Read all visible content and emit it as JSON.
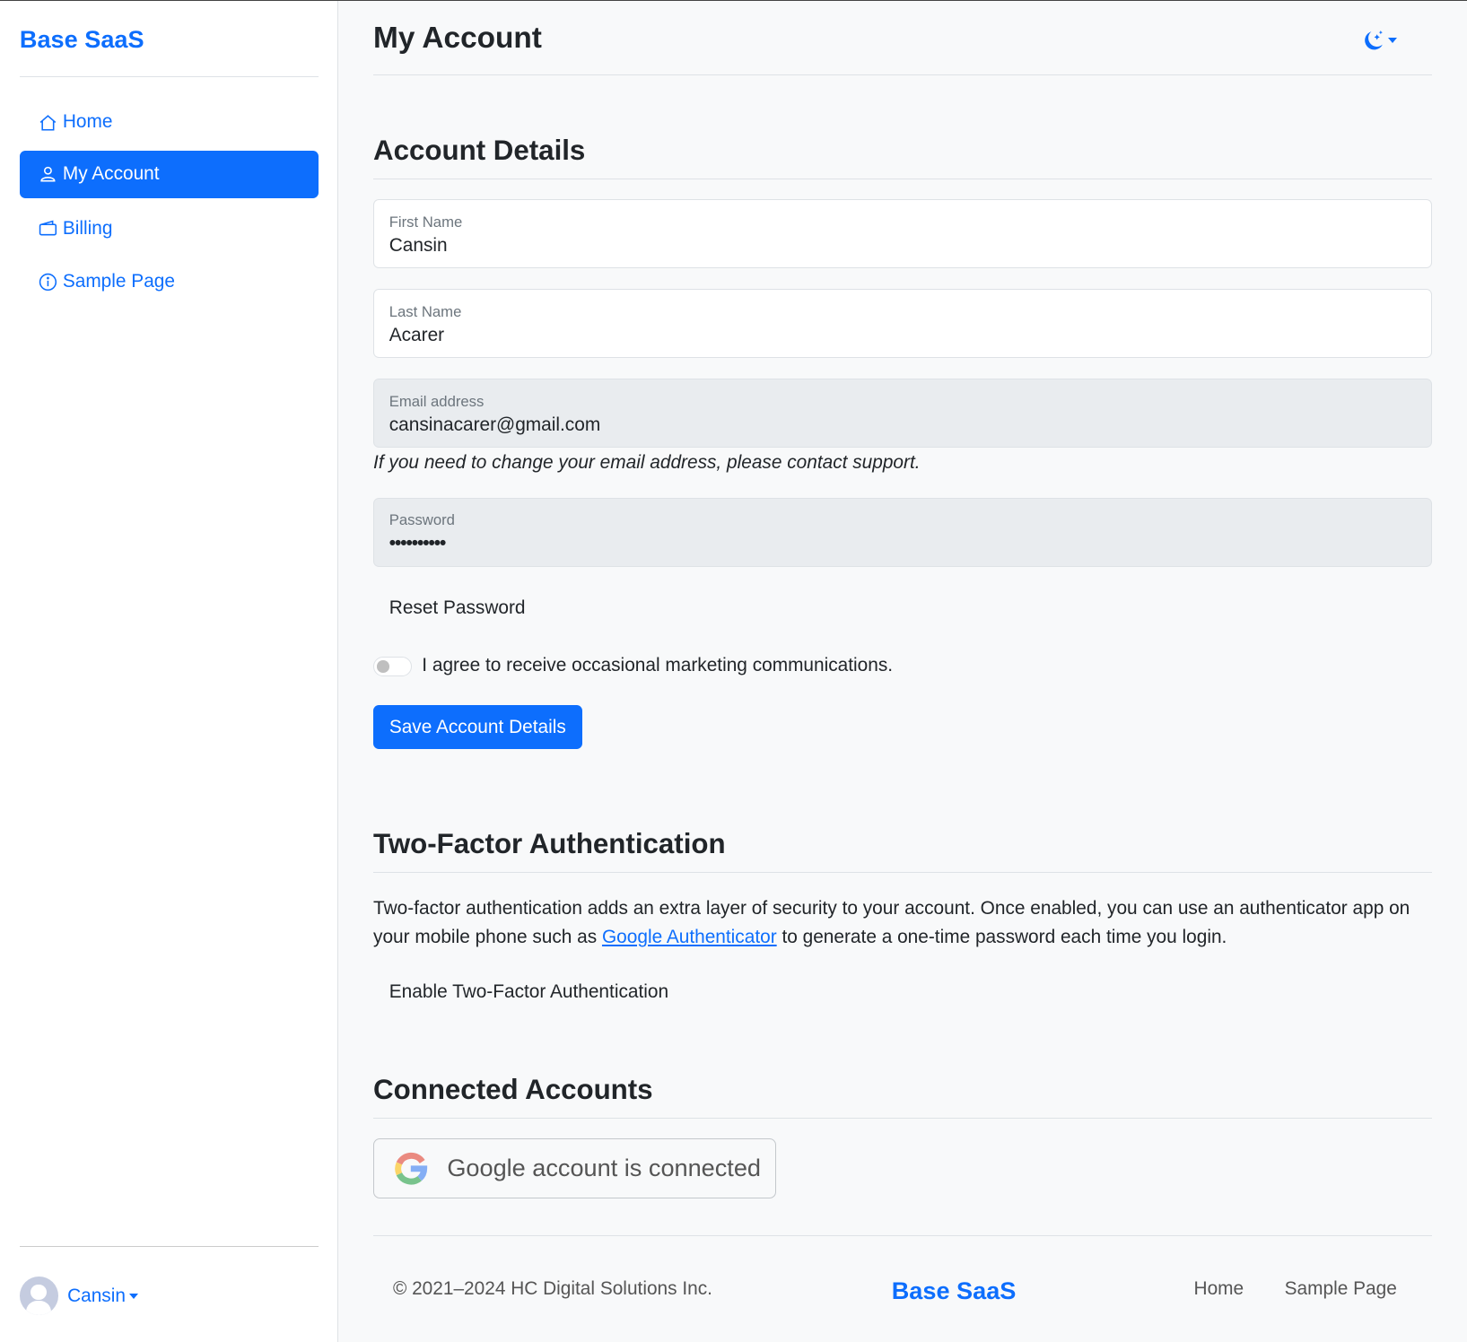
{
  "sidebar": {
    "brand": "Base SaaS",
    "items": [
      {
        "label": "Home",
        "icon": "house-icon"
      },
      {
        "label": "My Account",
        "icon": "person-icon",
        "active": true
      },
      {
        "label": "Billing",
        "icon": "wallet-icon"
      },
      {
        "label": "Sample Page",
        "icon": "info-circle-icon"
      }
    ],
    "user": {
      "name": "Cansin"
    }
  },
  "header": {
    "title": "My Account",
    "theme_icon": "moon-stars-icon"
  },
  "account": {
    "heading": "Account Details",
    "first_name": {
      "label": "First Name",
      "value": "Cansin"
    },
    "last_name": {
      "label": "Last Name",
      "value": "Acarer"
    },
    "email": {
      "label": "Email address",
      "value": "cansinacarer@gmail.com",
      "hint": "If you need to change your email address, please contact support."
    },
    "password": {
      "label": "Password",
      "value": "••••••••••"
    },
    "reset_password": "Reset Password",
    "marketing_toggle": {
      "label": "I agree to receive occasional marketing communications.",
      "checked": false
    },
    "save": "Save Account Details"
  },
  "twofa": {
    "heading": "Two-Factor Authentication",
    "text_before": "Two-factor authentication adds an extra layer of security to your account. Once enabled, you can use an authenticator app on your mobile phone such as ",
    "link": "Google Authenticator",
    "text_after": " to generate a one-time password each time you login.",
    "enable": "Enable Two-Factor Authentication"
  },
  "connected": {
    "heading": "Connected Accounts",
    "google": "Google account is connected"
  },
  "footer": {
    "copyright": "© 2021–2024 HC Digital Solutions Inc.",
    "brand": "Base SaaS",
    "links": [
      "Home",
      "Sample Page"
    ]
  },
  "colors": {
    "primary": "#0d6efd",
    "background": "#f8f9fa"
  }
}
